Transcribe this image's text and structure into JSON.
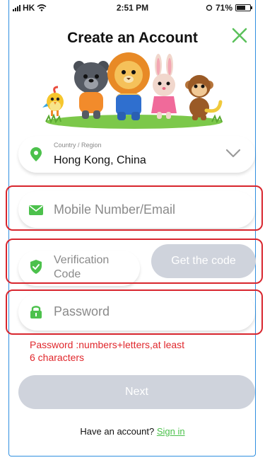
{
  "status": {
    "carrier": "HK",
    "time": "2:51 PM",
    "battery": "71%"
  },
  "header": {
    "title": "Create an Account",
    "close_icon": "close-icon"
  },
  "country": {
    "label": "Country / Region",
    "value": "Hong Kong, China"
  },
  "contact": {
    "placeholder": "Mobile Number/Email"
  },
  "verification": {
    "placeholder_line1": "Verification",
    "placeholder_line2": "Code",
    "get_code_label": "Get the code"
  },
  "password": {
    "placeholder": "Password",
    "hint_line1": "Password :numbers+letters,at least",
    "hint_line2": "6 characters"
  },
  "actions": {
    "next_label": "Next"
  },
  "footer": {
    "prompt": "Have an account?",
    "link": "Sign in"
  },
  "colors": {
    "accent": "#4cc14c",
    "error": "#e0272c",
    "disabled": "#cfd3dc",
    "highlight": "#d8262e"
  }
}
